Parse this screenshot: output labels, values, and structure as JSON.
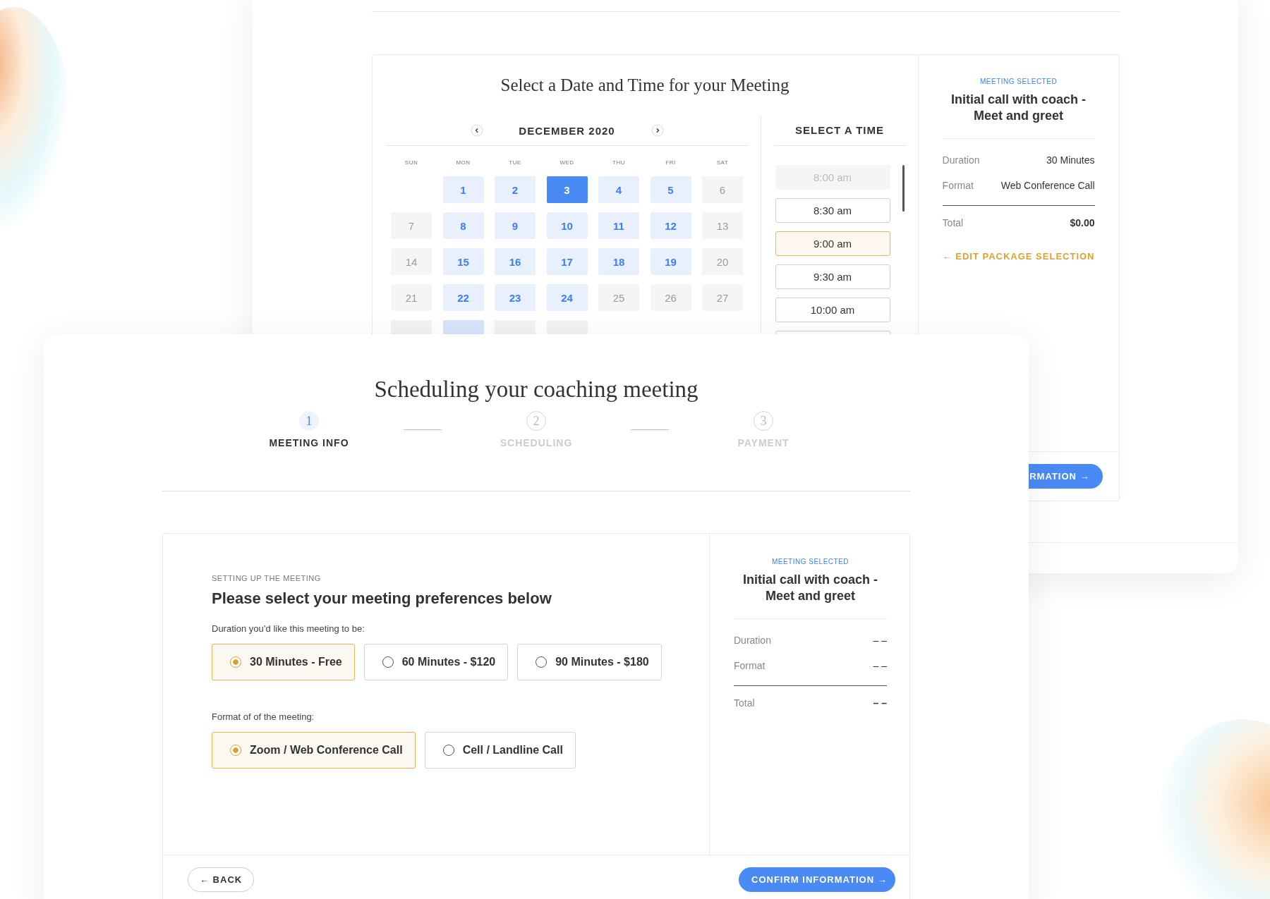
{
  "background_window": {
    "title": "Select a Date and Time for your Meeting",
    "calendar": {
      "month": "DECEMBER 2020",
      "weekdays": [
        "SUN",
        "MON",
        "TUE",
        "WED",
        "THU",
        "FRI",
        "SAT"
      ],
      "weeks": [
        [
          {
            "kind": "blank"
          },
          {
            "kind": "day",
            "day": "1",
            "available": true,
            "selected": false
          },
          {
            "kind": "day",
            "day": "2",
            "available": true,
            "selected": false
          },
          {
            "kind": "day",
            "day": "3",
            "available": true,
            "selected": true
          },
          {
            "kind": "day",
            "day": "4",
            "available": true,
            "selected": false
          },
          {
            "kind": "day",
            "day": "5",
            "available": true,
            "selected": false
          },
          {
            "kind": "day",
            "day": "6",
            "available": false,
            "selected": false
          }
        ],
        [
          {
            "kind": "day",
            "day": "7",
            "available": false,
            "selected": false
          },
          {
            "kind": "day",
            "day": "8",
            "available": true,
            "selected": false
          },
          {
            "kind": "day",
            "day": "9",
            "available": true,
            "selected": false
          },
          {
            "kind": "day",
            "day": "10",
            "available": true,
            "selected": false
          },
          {
            "kind": "day",
            "day": "11",
            "available": true,
            "selected": false
          },
          {
            "kind": "day",
            "day": "12",
            "available": true,
            "selected": false
          },
          {
            "kind": "day",
            "day": "13",
            "available": false,
            "selected": false
          }
        ],
        [
          {
            "kind": "day",
            "day": "14",
            "available": false,
            "selected": false
          },
          {
            "kind": "day",
            "day": "15",
            "available": true,
            "selected": false
          },
          {
            "kind": "day",
            "day": "16",
            "available": true,
            "selected": false
          },
          {
            "kind": "day",
            "day": "17",
            "available": true,
            "selected": false
          },
          {
            "kind": "day",
            "day": "18",
            "available": true,
            "selected": false
          },
          {
            "kind": "day",
            "day": "19",
            "available": true,
            "selected": false
          },
          {
            "kind": "day",
            "day": "20",
            "available": false,
            "selected": false
          }
        ],
        [
          {
            "kind": "day",
            "day": "21",
            "available": false,
            "selected": false
          },
          {
            "kind": "day",
            "day": "22",
            "available": true,
            "selected": false
          },
          {
            "kind": "day",
            "day": "23",
            "available": true,
            "selected": false
          },
          {
            "kind": "day",
            "day": "24",
            "available": true,
            "selected": false
          },
          {
            "kind": "day",
            "day": "25",
            "available": false,
            "selected": false
          },
          {
            "kind": "day",
            "day": "26",
            "available": false,
            "selected": false
          },
          {
            "kind": "day",
            "day": "27",
            "available": false,
            "selected": false
          }
        ],
        [
          {
            "kind": "partial",
            "available": false
          },
          {
            "kind": "partial",
            "available": true
          },
          {
            "kind": "partial",
            "available": false
          },
          {
            "kind": "partial",
            "available": false
          }
        ]
      ]
    },
    "time_header": "SELECT A TIME",
    "time_slots": [
      {
        "label": "8:00 am",
        "disabled": true,
        "selected": false
      },
      {
        "label": "8:30 am",
        "disabled": false,
        "selected": false
      },
      {
        "label": "9:00 am",
        "disabled": false,
        "selected": true
      },
      {
        "label": "9:30 am",
        "disabled": false,
        "selected": false
      },
      {
        "label": "10:00 am",
        "disabled": false,
        "selected": false
      }
    ],
    "summary": {
      "eyebrow": "MEETING SELECTED",
      "title": "Initial call with coach - Meet and greet",
      "rows": [
        {
          "label": "Duration",
          "value": "30 Minutes"
        },
        {
          "label": "Format",
          "value": "Web Conference Call"
        }
      ],
      "total": {
        "label": "Total",
        "value": "$0.00"
      },
      "edit_link": "← EDIT PACKAGE SELECTION"
    },
    "confirm_button": "RMATION →"
  },
  "front_window": {
    "title": "Scheduling your coaching meeting",
    "steps": [
      {
        "number": "1",
        "label": "MEETING INFO",
        "selected": true
      },
      {
        "number": "2",
        "label": "SCHEDULING",
        "selected": false
      },
      {
        "number": "3",
        "label": "PAYMENT",
        "selected": false
      }
    ],
    "eyebrow": "SETTING UP THE MEETING",
    "heading": "Please select your meeting preferences below",
    "duration_label": "Duration you’d like this meeting to be:",
    "duration_options": [
      {
        "label": "30 Minutes - Free",
        "selected": true
      },
      {
        "label": "60 Minutes - $120",
        "selected": false
      },
      {
        "label": "90 Minutes - $180",
        "selected": false
      }
    ],
    "format_label": "Format of of the meeting:",
    "format_options": [
      {
        "label": "Zoom / Web Conference Call",
        "selected": true
      },
      {
        "label": "Cell / Landline Call",
        "selected": false
      }
    ],
    "summary": {
      "eyebrow": "MEETING SELECTED",
      "title": "Initial call with coach - Meet and greet",
      "rows": [
        {
          "label": "Duration",
          "value": "– –"
        },
        {
          "label": "Format",
          "value": "– –"
        }
      ],
      "total": {
        "label": "Total",
        "value": "– –"
      }
    },
    "back_button": "← BACK",
    "confirm_button": "CONFIRM INFORMATION →"
  }
}
